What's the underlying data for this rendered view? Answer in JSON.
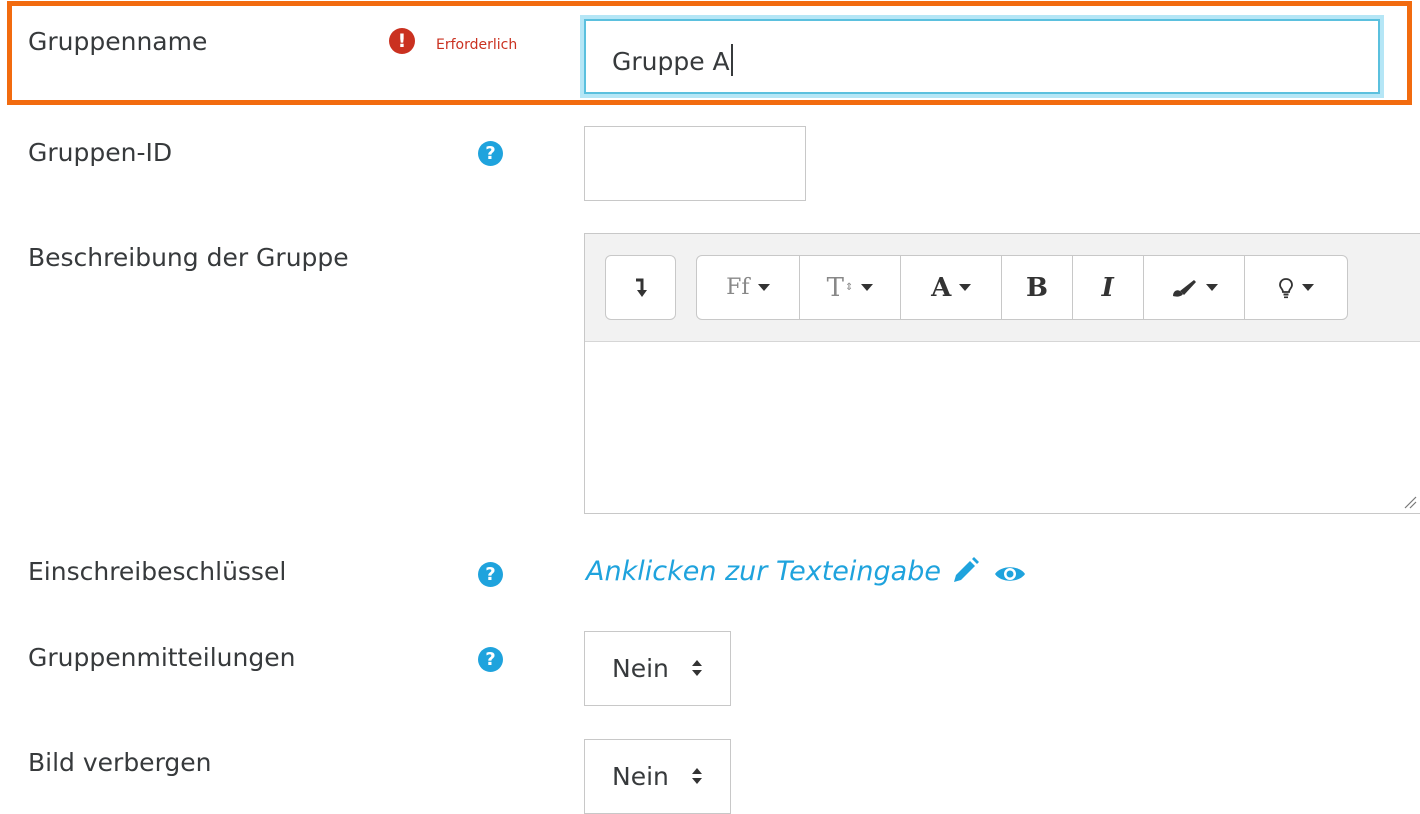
{
  "form": {
    "group_name": {
      "label": "Gruppenname",
      "required_text": "Erforderlich",
      "value": "Gruppe A"
    },
    "group_id": {
      "label": "Gruppen-ID",
      "value": ""
    },
    "description": {
      "label": "Beschreibung der Gruppe",
      "toolbar": {
        "font_family_label": "Ff",
        "font_size_label": "T",
        "font_color_label": "A",
        "bold_label": "B",
        "italic_label": "I"
      },
      "value": ""
    },
    "enrolment_key": {
      "label": "Einschreibeschlüssel",
      "link_text": "Anklicken zur Texteingabe"
    },
    "group_messaging": {
      "label": "Gruppenmitteilungen",
      "value": "Nein"
    },
    "hide_picture": {
      "label": "Bild verbergen",
      "value": "Nein"
    }
  },
  "colors": {
    "highlight_border": "#f26b0f",
    "required_red": "#ca3120",
    "help_blue": "#1fa3dd",
    "focus_border": "#5bc0de"
  },
  "icons": {
    "required": "exclamation-circle-icon",
    "help": "question-circle-icon",
    "edit": "pencil-icon",
    "reveal": "eye-icon",
    "select": "sort-arrows-icon"
  }
}
